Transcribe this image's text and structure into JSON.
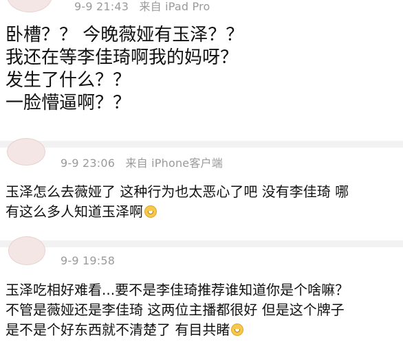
{
  "posts": [
    {
      "time": "9-9 21:43",
      "source": "来自 iPad Pro",
      "lines": [
        "卧槽？？ 今晚薇娅有玉泽？？",
        "我还在等李佳琦啊我的妈呀？",
        "发生了什么？？",
        "一脸懵逼啊？？"
      ]
    },
    {
      "time": "9-9 23:06",
      "source": "来自 iPhone客户端",
      "lines": [
        "玉泽怎么去薇娅了 这种行为也太恶心了吧 没有李佳琦 哪",
        "有这么多人知道玉泽啊"
      ],
      "emoji": "laughing-tears-emoji"
    },
    {
      "time": "9-9 19:58",
      "lines": [
        "玉泽吃相好难看...要不是李佳琦推荐谁知道你是个啥嘛？",
        "不管是薇娅还是李佳琦 这两位主播都很好 但是这个牌子",
        "是不是个好东西就不清楚了 有目共睹"
      ],
      "emoji": "grinning-emoji"
    }
  ]
}
